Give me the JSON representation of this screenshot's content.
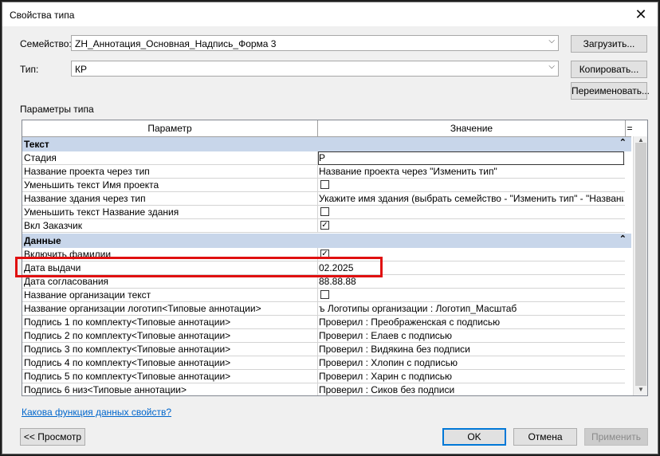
{
  "window": {
    "title": "Свойства типа"
  },
  "family": {
    "label": "Семейство:",
    "value": "ZH_Аннотация_Основная_Надпись_Форма 3"
  },
  "type": {
    "label": "Тип:",
    "value": "КР"
  },
  "buttons": {
    "load": "Загрузить...",
    "copy": "Копировать...",
    "rename": "Переименовать...",
    "preview": "<< Просмотр",
    "ok": "OK",
    "cancel": "Отмена",
    "apply": "Применить"
  },
  "params_label": "Параметры типа",
  "grid": {
    "col_param": "Параметр",
    "col_value": "Значение",
    "menu_glyph": "="
  },
  "groups": {
    "text": "Текст",
    "data": "Данные"
  },
  "rows": [
    {
      "name": "Стадия",
      "value": "Р"
    },
    {
      "name": "Название проекта через тип",
      "value": "Название проекта через \"Изменить тип\""
    },
    {
      "name": "Уменьшить текст Имя проекта",
      "checked": false
    },
    {
      "name": "Название здания через тип",
      "value": "Укажите имя здания (выбрать семейство - \"Изменить тип\" - \"Название зда"
    },
    {
      "name": "Уменьшить текст Название здания",
      "checked": false
    },
    {
      "name": "Вкл Заказчик",
      "checked": true
    },
    {
      "name": "Включить фамилии",
      "checked": true
    },
    {
      "name": "Дата выдачи",
      "value": "02.2025"
    },
    {
      "name": "Дата согласования",
      "value": "88.88.88"
    },
    {
      "name": "Название организации текст",
      "checked": false
    },
    {
      "name": "Название организации логотип<Типовые аннотации>",
      "value": "ъ Логотипы организации : Логотип_Масштаб"
    },
    {
      "name": "Подпись 1 по комплекту<Типовые аннотации>",
      "value": "Проверил : Преображенская с подписью"
    },
    {
      "name": "Подпись 2 по комплекту<Типовые аннотации>",
      "value": "Проверил : Елаев с подписью"
    },
    {
      "name": "Подпись 3 по комплекту<Типовые аннотации>",
      "value": "Проверил : Видякина без подписи"
    },
    {
      "name": "Подпись 4 по комплекту<Типовые аннотации>",
      "value": "Проверил : Хлопин с подписью"
    },
    {
      "name": "Подпись 5 по комплекту<Типовые аннотации>",
      "value": "Проверил : Харин с подписью"
    },
    {
      "name": "Подпись 6 низ<Типовые аннотации>",
      "value": "Проверил : Сиков без подписи"
    }
  ],
  "help_link": "Какова функция данных свойств?",
  "colors": {
    "highlight": "#e01010",
    "group_bg": "#c8d6ea",
    "link": "#0066cc"
  }
}
